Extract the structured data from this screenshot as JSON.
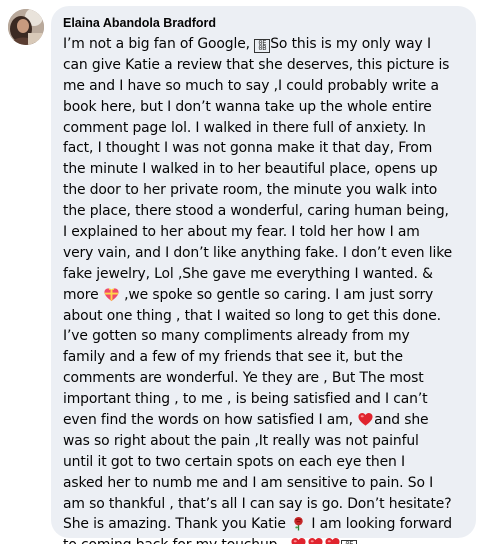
{
  "comment": {
    "author": "Elaina Abandola Bradford",
    "avatar_icon": "profile-photo",
    "lines": [
      [
        {
          "t": "I’m not a big fan of Google, "
        },
        {
          "e": "unsupported-char-icon",
          "code": "0E\n0B"
        },
        {
          "t": "So this is my only way I"
        }
      ],
      [
        {
          "t": "can give Katie a review that she deserves, this picture is"
        }
      ],
      [
        {
          "t": "me and I have so much to say ,I could probably write a"
        }
      ],
      [
        {
          "t": "book here, but I don’t wanna take up the whole entire"
        }
      ],
      [
        {
          "t": "comment page lol. I walked in there full of anxiety. In"
        }
      ],
      [
        {
          "t": "fact, I thought I was not gonna make it that day, From"
        }
      ],
      [
        {
          "t": "the minute I walked in to her beautiful place, opens up"
        }
      ],
      [
        {
          "t": "the door to her private room, the minute you walk into"
        }
      ],
      [
        {
          "t": "the place, there stood a wonderful, caring human being,"
        }
      ],
      [
        {
          "t": "I explained to her about my fear. I told her how I am"
        }
      ],
      [
        {
          "t": "very vain, and I don’t like anything fake. I don’t even like"
        }
      ],
      [
        {
          "t": "fake jewelry, Lol ,She gave me everything I wanted. &"
        }
      ],
      [
        {
          "t": "more "
        },
        {
          "e": "gift-heart-icon"
        },
        {
          "t": " ,we spoke so gentle so caring. I am just sorry"
        }
      ],
      [
        {
          "t": "about one thing , that I waited so long to get this done."
        }
      ],
      [
        {
          "t": "I’ve gotten so many compliments already from my"
        }
      ],
      [
        {
          "t": "family and a few of my friends that see it, but the"
        }
      ],
      [
        {
          "t": "comments are wonderful. Ye they are , But The most"
        }
      ],
      [
        {
          "t": "important thing , to me , is being satisfied and I can’t"
        }
      ],
      [
        {
          "t": "even find the words on how satisfied I am, "
        },
        {
          "e": "red-heart-icon"
        },
        {
          "t": "and she"
        }
      ],
      [
        {
          "t": "was so right about the pain ,It really was not painful"
        }
      ],
      [
        {
          "t": "until it got to two certain spots on each eye then I"
        }
      ],
      [
        {
          "t": "asked her to numb me and I am sensitive to pain. So I"
        }
      ],
      [
        {
          "t": "am so thankful , that’s all I can say is go. Don’t hesitate?"
        }
      ],
      [
        {
          "t": "She is amazing. Thank you Katie "
        },
        {
          "e": "rose-icon"
        },
        {
          "t": " I am looking forward"
        }
      ],
      [
        {
          "t": "to coming back for my touchup .."
        },
        {
          "e": "red-heart-icon"
        },
        {
          "e": "red-heart-icon"
        },
        {
          "e": "red-heart-icon"
        },
        {
          "e": "unsupported-char-icon",
          "code": "0E\n0B"
        }
      ]
    ]
  },
  "colors": {
    "bubble_bg": "#eceff4",
    "text": "#050505",
    "heart": "#e0242e"
  }
}
